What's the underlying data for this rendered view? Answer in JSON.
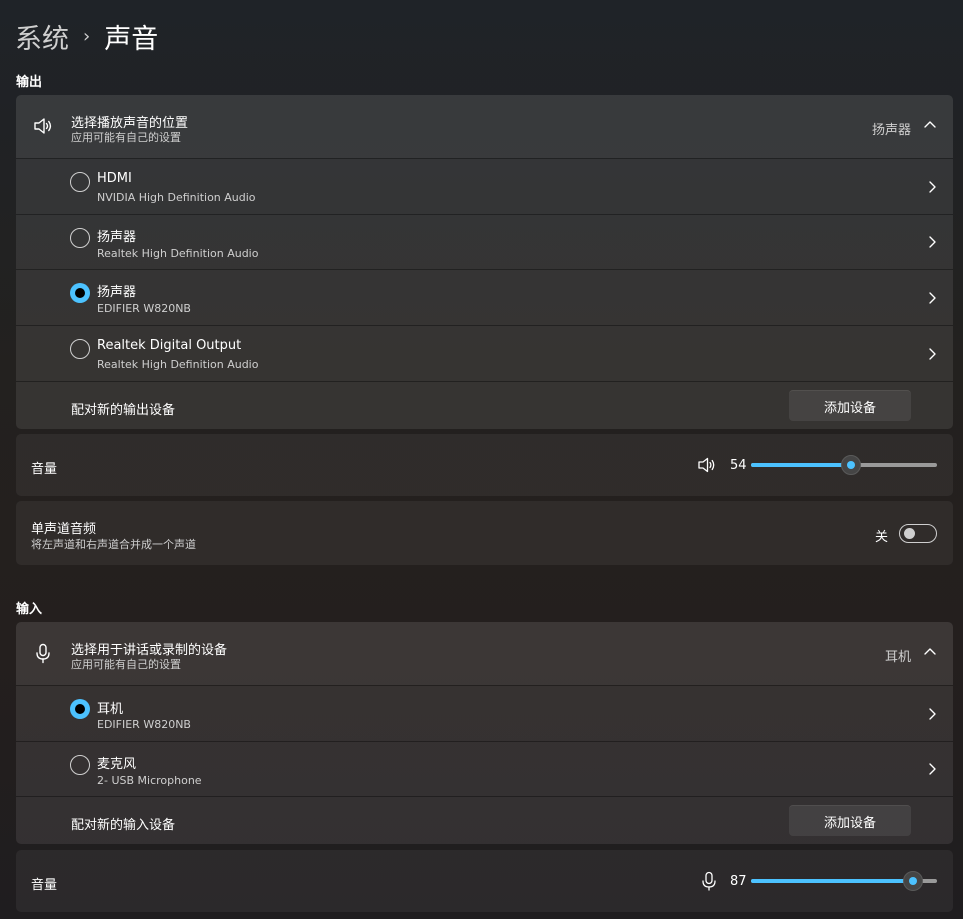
{
  "breadcrumb": {
    "parent": "系统",
    "separator": "›",
    "current": "声音"
  },
  "output": {
    "section_label": "输出",
    "header": {
      "title": "选择播放声音的位置",
      "subtitle": "应用可能有自己的设置",
      "value": "扬声器"
    },
    "devices": [
      {
        "name": "HDMI",
        "detail": "NVIDIA High Definition Audio",
        "selected": false
      },
      {
        "name": "扬声器",
        "detail": "Realtek High Definition Audio",
        "selected": false
      },
      {
        "name": "扬声器",
        "detail": "EDIFIER W820NB",
        "selected": true
      },
      {
        "name": "Realtek Digital Output",
        "detail": "Realtek High Definition Audio",
        "selected": false
      }
    ],
    "pair": {
      "label": "配对新的输出设备",
      "button": "添加设备"
    },
    "volume": {
      "label": "音量",
      "value": "54",
      "level": 54
    },
    "mono": {
      "label": "单声道音频",
      "subtitle": "将左声道和右声道合并成一个声道",
      "state": "关"
    }
  },
  "input": {
    "section_label": "输入",
    "header": {
      "title": "选择用于讲话或录制的设备",
      "subtitle": "应用可能有自己的设置",
      "value": "耳机"
    },
    "devices": [
      {
        "name": "耳机",
        "detail": "EDIFIER W820NB",
        "selected": true
      },
      {
        "name": "麦克风",
        "detail": "2- USB Microphone",
        "selected": false
      }
    ],
    "pair": {
      "label": "配对新的输入设备",
      "button": "添加设备"
    },
    "volume": {
      "label": "音量",
      "value": "87",
      "level": 87
    }
  },
  "colors": {
    "accent": "#4cc2ff",
    "background": "#202020"
  },
  "icons": [
    "speaker-icon",
    "microphone-icon",
    "chevron-up-icon",
    "chevron-right-icon"
  ]
}
